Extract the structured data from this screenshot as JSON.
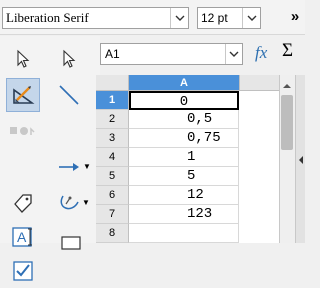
{
  "toolbar": {
    "font_name": "Liberation Serif",
    "font_size": "12 pt",
    "overflow_glyph": "»"
  },
  "formula_bar": {
    "name_box": "A1",
    "fx_label": "fx",
    "sum_glyph": "Σ"
  },
  "sheet": {
    "column_header": "A",
    "rows": [
      {
        "n": "1",
        "value": "0"
      },
      {
        "n": "2",
        "value": "0,5"
      },
      {
        "n": "3",
        "value": "0,75"
      },
      {
        "n": "4",
        "value": "1"
      },
      {
        "n": "5",
        "value": "5"
      },
      {
        "n": "6",
        "value": "12"
      },
      {
        "n": "7",
        "value": "123"
      },
      {
        "n": "8",
        "value": ""
      }
    ]
  },
  "icons": [
    "select-arrow-icon",
    "points-arrow-icon",
    "drawing-icon",
    "line-icon",
    "glue-points-icon",
    "arrow-line-icon",
    "tag-icon",
    "curve-icon",
    "textbox-icon",
    "rectangle-icon",
    "checkbox-icon"
  ],
  "colors": {
    "accent": "#4a90d9",
    "selected_tool_bg": "#c4d6ea"
  }
}
